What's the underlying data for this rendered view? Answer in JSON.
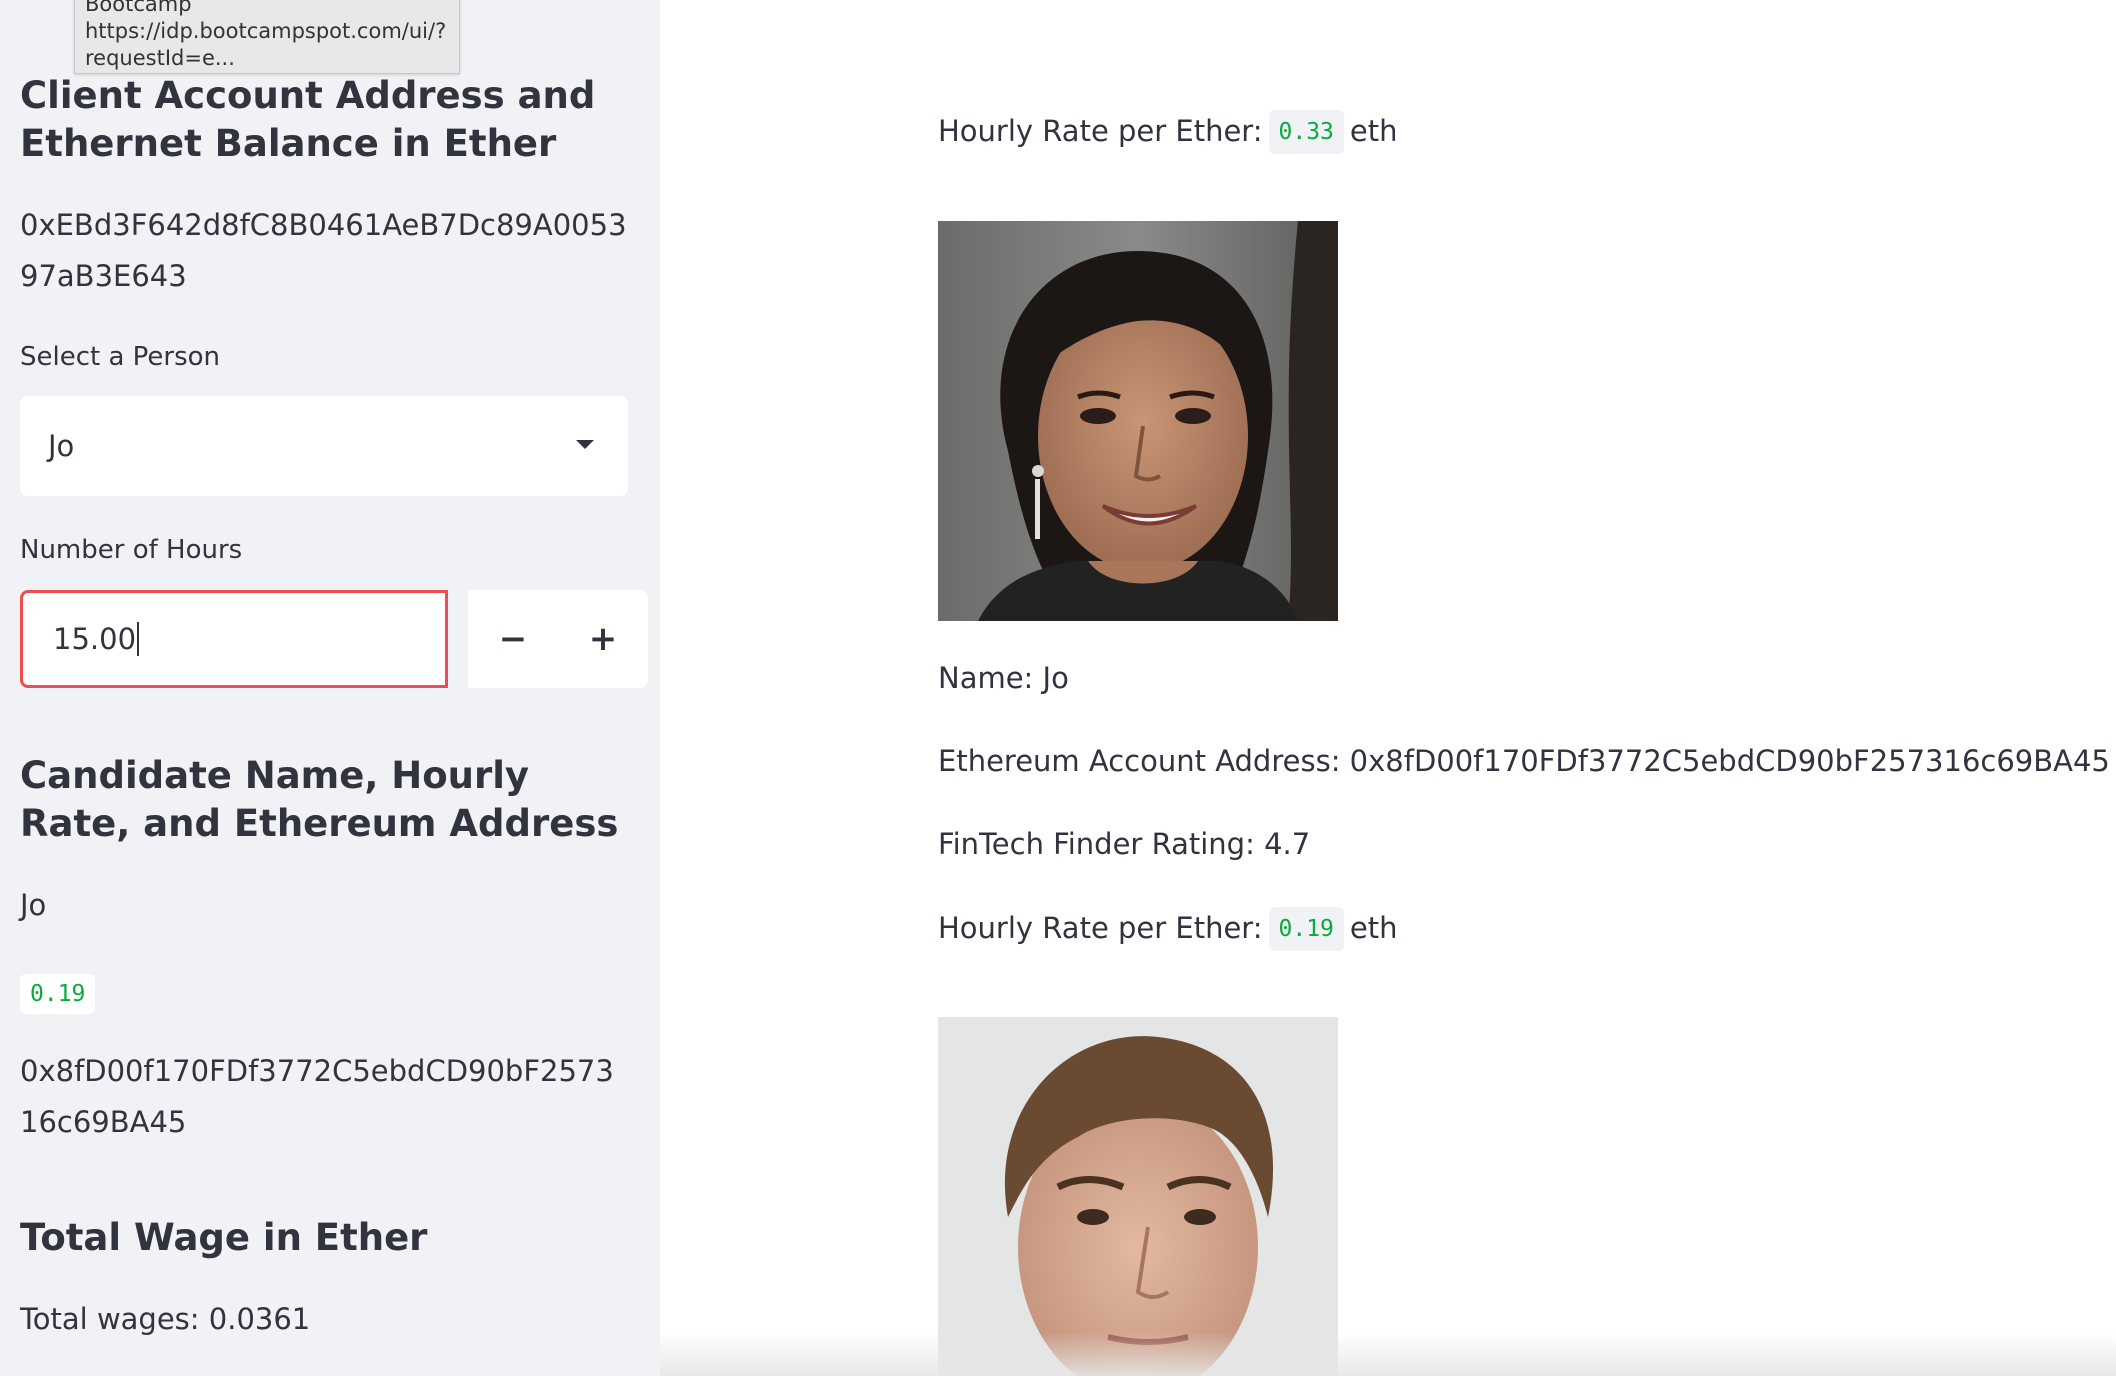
{
  "tooltip": {
    "line1": "Bootcamp",
    "line2": "https://idp.bootcampspot.com/ui/?",
    "line3": "requestId=e..."
  },
  "sidebar": {
    "account_heading": "Client Account Address and Ethernet Balance in Ether",
    "account_address": "0xEBd3F642d8fC8B0461AeB7Dc89A005397aB3E643",
    "select_label": "Select a Person",
    "select_value": "Jo",
    "hours_label": "Number of Hours",
    "hours_value": "15.00",
    "minus_label": "−",
    "plus_label": "+",
    "candidate_heading": "Candidate Name, Hourly Rate, and Ethereum Address",
    "candidate_name": "Jo",
    "candidate_rate": "0.19",
    "candidate_address": "0x8fD00f170FDf3772C5ebdCD90bF257316c69BA45",
    "wage_heading": "Total Wage in Ether",
    "total_wages": "Total wages: 0.0361"
  },
  "main": {
    "rate_label": "Hourly Rate per Ether:",
    "rate_unit": "eth",
    "top_rate": "0.33",
    "person1": {
      "name": "Name: Jo",
      "address": "Ethereum Account Address: 0x8fD00f170FDf3772C5ebdCD90bF257316c69BA45",
      "rating": "FinTech Finder Rating: 4.7",
      "rate": "0.19"
    }
  }
}
